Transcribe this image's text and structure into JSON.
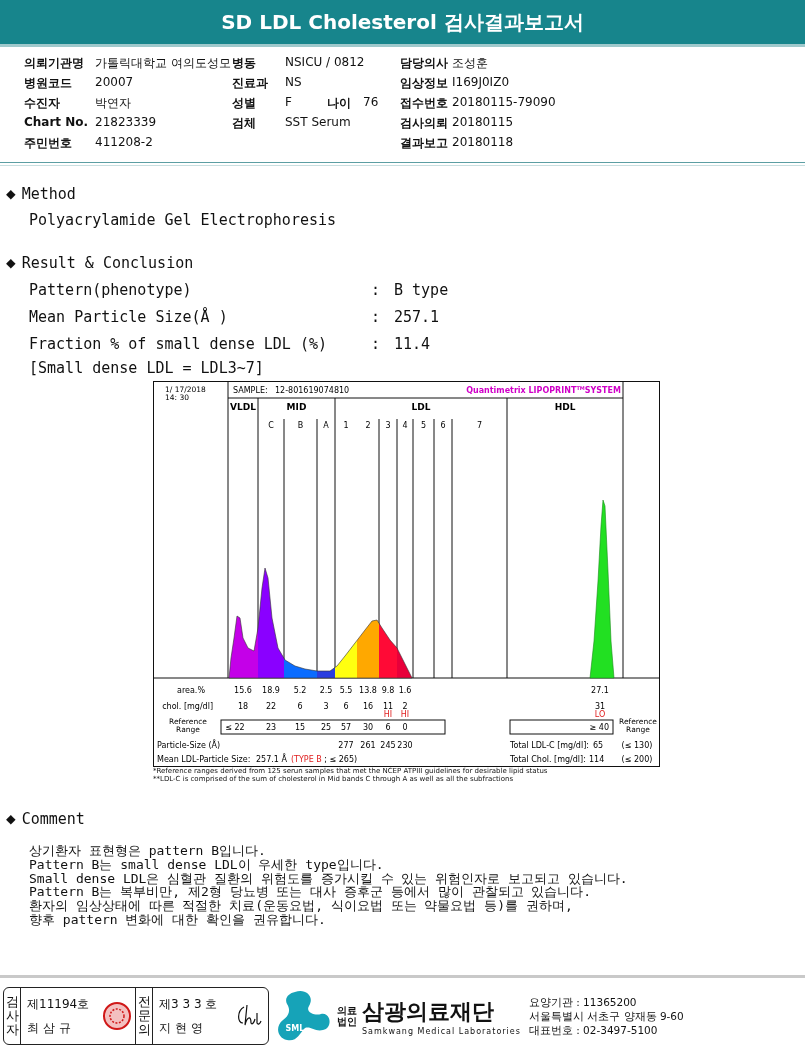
{
  "title": "SD LDL Cholesterol 검사결과보고서",
  "info": [
    {
      "left": {
        "label": "의뢰기관명",
        "value": "가톨릭대학교 여의도성모"
      },
      "middle": {
        "label": "병동",
        "value": "NSICU / 0812"
      },
      "right": {
        "label": "담당의사",
        "value": "조성훈"
      }
    },
    {
      "left": {
        "label": "병원코드",
        "value": "20007"
      },
      "middle": {
        "label": "진료과",
        "value": "NS"
      },
      "right": {
        "label": "임상정보",
        "value": "I169J0IZ0"
      }
    },
    {
      "left": {
        "label": "수진자",
        "value": "박연자"
      },
      "middle": {
        "label": "성별",
        "value": "F",
        "extra_label": "나이",
        "extra_value": "76"
      },
      "right": {
        "label": "접수번호",
        "value": "20180115-79090"
      }
    },
    {
      "left": {
        "label": "Chart No.",
        "value": "21823339"
      },
      "middle": {
        "label": "검체",
        "value": "SST Serum"
      },
      "right": {
        "label": "검사의뢰",
        "value": "20180115"
      }
    },
    {
      "left": {
        "label": "주민번호",
        "value": "411208-2"
      },
      "right": {
        "label": "결과보고",
        "value": "20180118"
      }
    }
  ],
  "method": {
    "bullet": "◆",
    "title": "Method",
    "text": "Polyacrylamide Gel Electrophoresis"
  },
  "result": {
    "bullet": "◆",
    "title": "Result & Conclusion",
    "items": [
      {
        "label": "Pattern(phenotype)",
        "colon": ":",
        "value": "B type"
      },
      {
        "label": "Mean Particle Size(Å )",
        "colon": ":",
        "value": "257.1"
      },
      {
        "label": "Fraction % of small dense LDL (%)",
        "colon": ":",
        "value": "11.4"
      }
    ],
    "note": "[Small dense LDL = LDL3~7]"
  },
  "chart": {
    "date": "1/ 17/2018",
    "time": "14: 30",
    "sample_label": "SAMPLE:",
    "sample_id": "12-801619074810",
    "brand": "Quantimetrix LIPOPRINT",
    "brand_mark": "TM",
    "brand_suffix": "SYSTEM",
    "groups": [
      {
        "label": "VLDL"
      },
      {
        "label": "MID",
        "subs": [
          "C",
          "B",
          "A"
        ]
      },
      {
        "label": "LDL",
        "subs": [
          "1",
          "2",
          "3",
          "4",
          "5",
          "6",
          "7"
        ]
      },
      {
        "label": "HDL"
      }
    ],
    "area": {
      "label": "area.%",
      "values": [
        "15.6",
        "18.9",
        "5.2",
        "2.5",
        "5.5",
        "13.8",
        "9.8",
        "1.6",
        "27.1"
      ]
    },
    "chol": {
      "label": "chol. [mg/dl]",
      "values": [
        {
          "text": "18"
        },
        {
          "text": "22"
        },
        {
          "text": "6"
        },
        {
          "text": "3"
        },
        {
          "text": "6"
        },
        {
          "text": "16"
        },
        {
          "text": "11",
          "flag": "HI"
        },
        {
          "text": "2",
          "flag": "HI"
        },
        {
          "text": "31",
          "flag": "LO"
        }
      ]
    },
    "reference": {
      "label": "Reference Range",
      "values": [
        "≤ 22",
        "23",
        "15",
        "25",
        "57",
        "30",
        "6",
        "0"
      ],
      "hdl": "≥ 40",
      "label_right": "Reference Range"
    },
    "particle": {
      "label": "Particle-Size (Å)",
      "values": [
        "277",
        "261",
        "245",
        "230"
      ]
    },
    "total_ldl": {
      "label": "Total LDL-C [mg/dl]:",
      "value": "65",
      "range": "(≤ 130)"
    },
    "mean": {
      "label": "Mean LDL-Particle Size:",
      "value": "257.1 Å",
      "flag": "(TYPE B",
      "rest": " ; ≤ 265)"
    },
    "total_chol": {
      "label": "Total Chol. [mg/dl]:",
      "value": "114",
      "range": "(≤ 200)"
    }
  },
  "footnotes": [
    "*Reference ranges derived from 125 serun samples that met the NCEP ATPIII guidelines for desirable lipid status",
    "**LDL-C is comprised of the sum of cholesterol in Mid bands C through A as well as all the subfractions"
  ],
  "comment": {
    "bullet": "◆",
    "title": "Comment",
    "lines": [
      "상기환자 표현형은 pattern B입니다.",
      "Pattern B는 small dense LDL이 우세한 type입니다.",
      "Small dense LDL은 심혈관 질환의 위험도를 증가시킬 수 있는 위험인자로 보고되고 있습니다.",
      "Pattern B는 복부비만, 제2형 당뇨병 또는 대사 증후군 등에서 많이 관찰되고 있습니다.",
      "환자의 임상상태에 따른 적절한 치료(운동요법, 식이요법 또는 약물요법 등)를 권하며,",
      "향후 pattern 변화에 대한 확인을 권유합니다."
    ]
  },
  "footer": {
    "signers": [
      {
        "role": "검사자",
        "number": "제11194호",
        "name": "최 삼 규",
        "kind": "seal"
      },
      {
        "role": "전문의",
        "number": "제3 3 3 호",
        "name": "지 현 영",
        "kind": "signature"
      }
    ],
    "logo_text": "SML",
    "org_type": "의료법인",
    "org_name": "삼광의료재단",
    "org_english": "Samkwang Medical Laboratories",
    "contact": [
      "요양기관 : 11365200",
      "서울특별시 서초구 양재동 9-60",
      "대표번호 : 02-3497-5100"
    ]
  }
}
